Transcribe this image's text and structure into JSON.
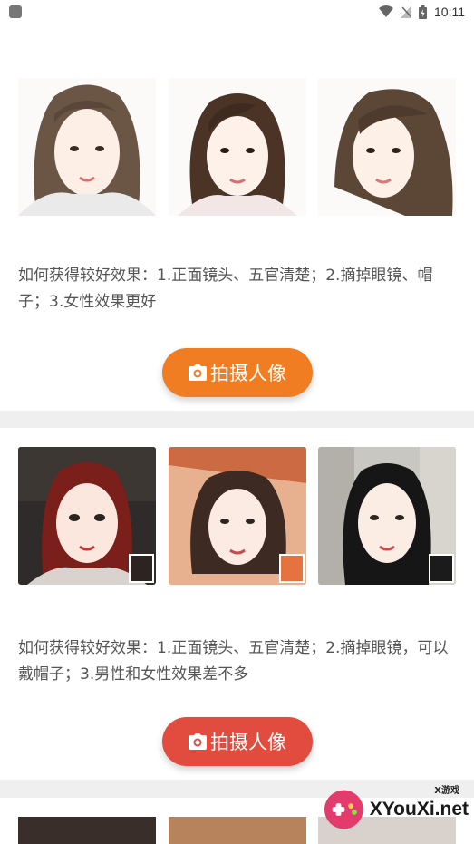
{
  "status": {
    "time": "10:11"
  },
  "cards": [
    {
      "description": "如何获得较好效果：1.正面镜头、五官清楚；2.摘掉眼镜、帽子；3.女性效果更好",
      "button_label": "拍摄人像",
      "button_color": "#f07d22"
    },
    {
      "description": "如何获得较好效果：1.正面镜头、五官清楚；2.摘掉眼镜，可以戴帽子；3.男性和女性效果差不多",
      "button_label": "拍摄人像",
      "button_color": "#e24c3f"
    }
  ],
  "watermark": {
    "text": "XYouXi.net",
    "small": "X游戏"
  },
  "icons": {
    "status_left": "notification-icon",
    "wifi": "wifi-icon",
    "signal": "signal-icon",
    "battery": "battery-icon",
    "camera": "camera-icon"
  }
}
